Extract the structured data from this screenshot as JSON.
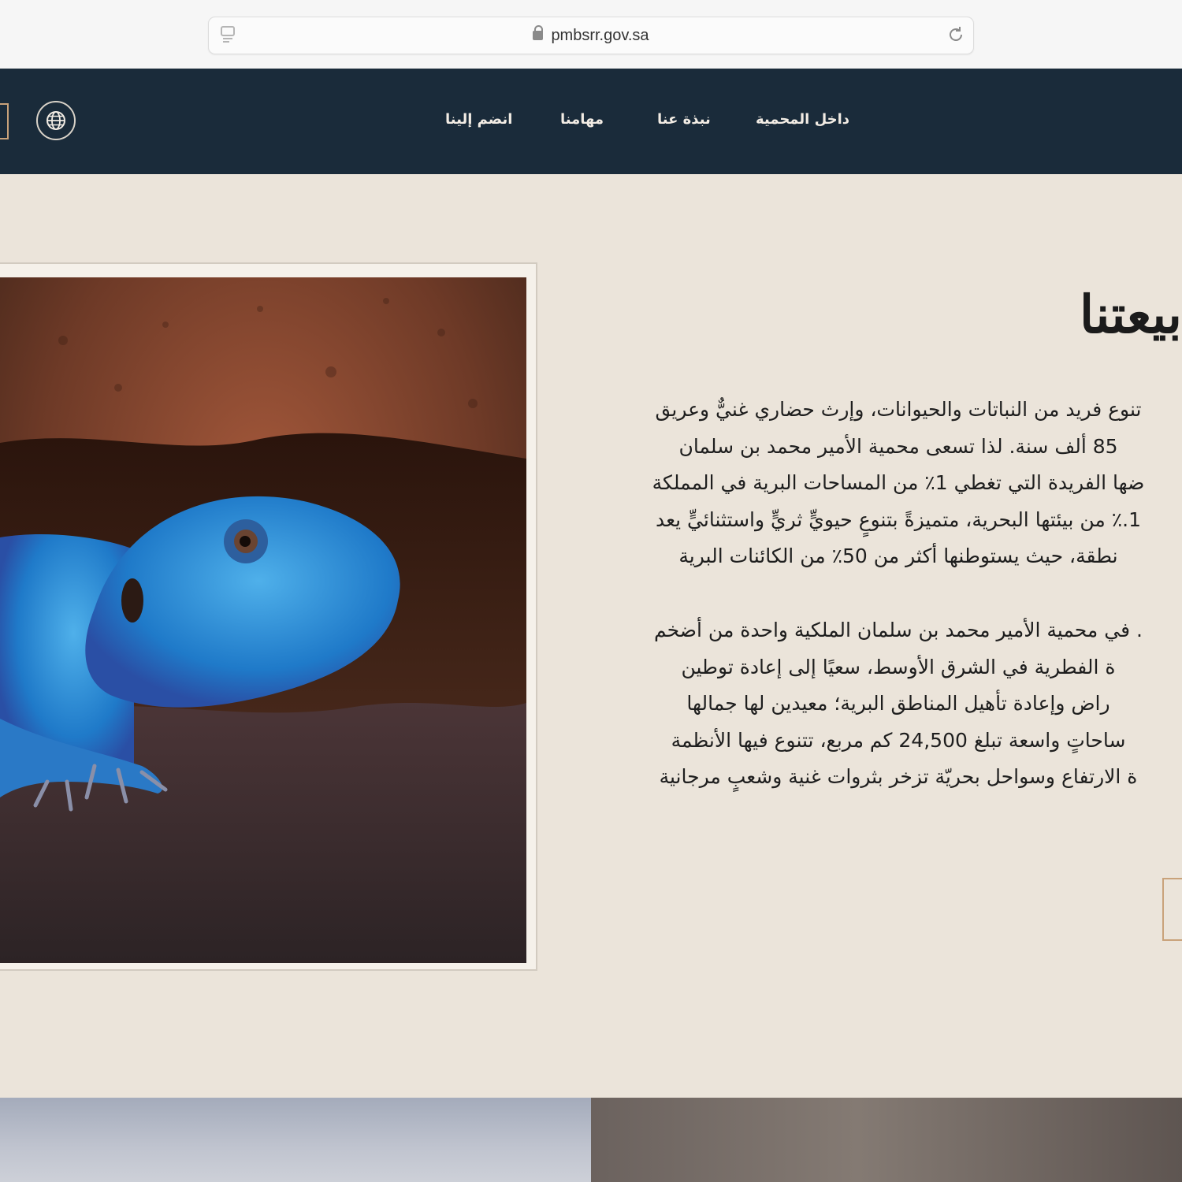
{
  "browser": {
    "url": "pmbsrr.gov.sa",
    "icons": {
      "site": "site-settings-icon",
      "lock": "lock-icon",
      "reload": "reload-icon"
    }
  },
  "header": {
    "nav": [
      {
        "label": "داخل المحمية"
      },
      {
        "label": "نبذة عنا"
      },
      {
        "label": "مهامنا"
      },
      {
        "label": "انضم إلينا"
      }
    ],
    "language_icon": "globe-icon",
    "background": "#1a2b3a"
  },
  "main": {
    "title": "بيعتنا",
    "paragraph1": [
      "تنوع فريد من النباتات والحيوانات، وإرث حضاري غنيٌّ وعريق",
      "85 ألف سنة. لذا تسعى محمية الأمير محمد بن سلمان",
      "ضها الفريدة التي تغطي 1٪ من المساحات البرية في المملكة",
      "1.٪ من بيئتها البحرية، متميزةً بتنوعٍ حيويٍّ ثريٍّ واستثنائيٍّ يعد",
      "نطقة، حيث يستوطنها أكثر من 50٪ من الكائنات البرية"
    ],
    "paragraph2": [
      ". في محمية الأمير محمد بن سلمان الملكية واحدة من أضخم",
      "ة الفطرية في الشرق الأوسط، سعيًا إلى إعادة توطين",
      "راض وإعادة تأهيل المناطق البرية؛ معيدين لها جمالها",
      "ساحاتٍ واسعة تبلغ 24,500 كم مربع، تتنوع فيها الأنظمة",
      "ة الارتفاع وسواحل بحريّة تزخر بثروات غنية وشعبٍ مرجانية"
    ],
    "photo": "blue-lizard-image",
    "background": "#ebe4da",
    "accent": "#c9a27a"
  }
}
